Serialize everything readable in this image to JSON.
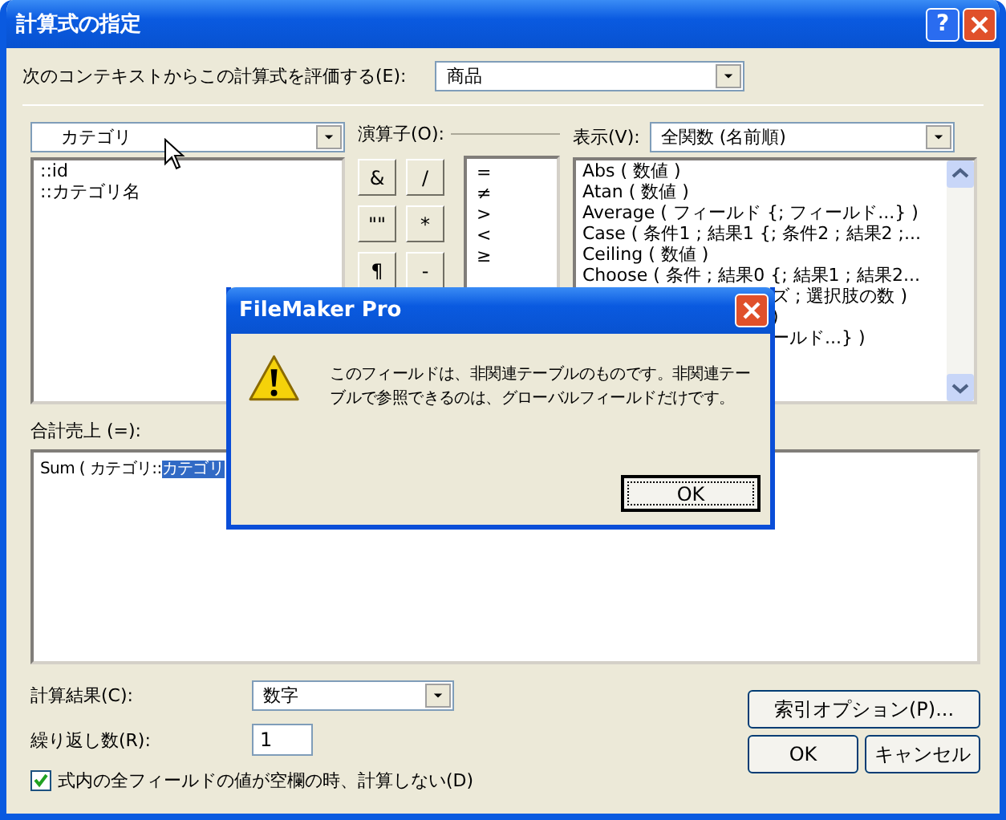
{
  "window": {
    "title": "計算式の指定",
    "help": "?"
  },
  "context": {
    "label": "次のコンテキストからこの計算式を評価する(E):",
    "value": "商品"
  },
  "table_select": {
    "value": "カテゴリ"
  },
  "fields": [
    "::id",
    "::カテゴリ名"
  ],
  "operators": {
    "label": "演算子(O):",
    "buttons": [
      "&",
      "/",
      "\"\"",
      "*",
      "¶",
      "-"
    ],
    "list": [
      "=",
      "≠",
      ">",
      "<",
      "≥"
    ]
  },
  "functions": {
    "label": "表示(V):",
    "value": "全関数 (名前順)",
    "items": [
      {
        "text": "Abs ( 数値 )",
        "clipped": false
      },
      {
        "text": "Atan ( 数値 )",
        "clipped": false
      },
      {
        "text": "Average ( フィールド {; フィールド...} )",
        "clipped": false
      },
      {
        "text": "Case ( 条件1 ; 結果1 {; 条件2 ; 結果2 ;...",
        "clipped": false
      },
      {
        "text": "Ceiling ( 数値 )",
        "clipped": false
      },
      {
        "text": "Choose ( 条件 ; 結果0 {; 結果1 ; 結果2...",
        "clipped": false
      },
      {
        "text": "ズ ; 選択肢の数 )",
        "clipped": true
      },
      {
        "text": ")",
        "clipped": true
      },
      {
        "text": "ールド...} )",
        "clipped": true
      }
    ]
  },
  "formula": {
    "label": "合計売上 (=):",
    "prefix": "Sum ( カテゴリ::",
    "selected": "カテゴリ"
  },
  "result_type": {
    "label": "計算結果(C):",
    "value": "数字"
  },
  "repetitions": {
    "label": "繰り返し数(R):",
    "value": "1"
  },
  "skip_empty": {
    "label": "式内の全フィールドの値が空欄の時、計算しない(D)",
    "checked": true
  },
  "buttons": {
    "index": "索引オプション(P)...",
    "ok": "OK",
    "cancel": "キャンセル"
  },
  "alert": {
    "title": "FileMaker Pro",
    "message": "このフィールドは、非関連テーブルのものです。非関連テーブルで参照できるのは、グローバルフィールドだけです。",
    "button": "OK"
  }
}
